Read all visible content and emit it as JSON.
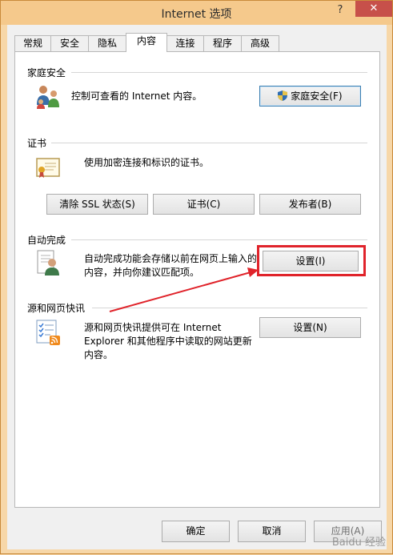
{
  "window": {
    "title": "Internet 选项",
    "help_glyph": "?",
    "close_glyph": "✕"
  },
  "tabs": [
    "常规",
    "安全",
    "隐私",
    "内容",
    "连接",
    "程序",
    "高级"
  ],
  "active_tab": "内容",
  "family_safety": {
    "title": "家庭安全",
    "desc": "控制可查看的 Internet 内容。",
    "button": "家庭安全(F)"
  },
  "certificates": {
    "title": "证书",
    "desc": "使用加密连接和标识的证书。",
    "buttons": [
      "清除 SSL 状态(S)",
      "证书(C)",
      "发布者(B)"
    ]
  },
  "autocomplete": {
    "title": "自动完成",
    "desc_line1": "自动完成功能会存储以前在网页上输入的",
    "desc_line2": "内容，并向你建议匹配项。",
    "button": "设置(I)"
  },
  "feeds": {
    "title": "源和网页快讯",
    "desc_line1": "源和网页快讯提供可在 Internet",
    "desc_line2": "Explorer 和其他程序中读取的网站更新",
    "desc_line3": "内容。",
    "button": "设置(N)"
  },
  "footer": {
    "ok": "确定",
    "cancel": "取消",
    "apply": "应用(A)"
  },
  "watermark": "Baidu 经验",
  "colors": {
    "annotation_red": "#e0242b",
    "title_bar": "#f5c98c",
    "close": "#c7504a"
  }
}
